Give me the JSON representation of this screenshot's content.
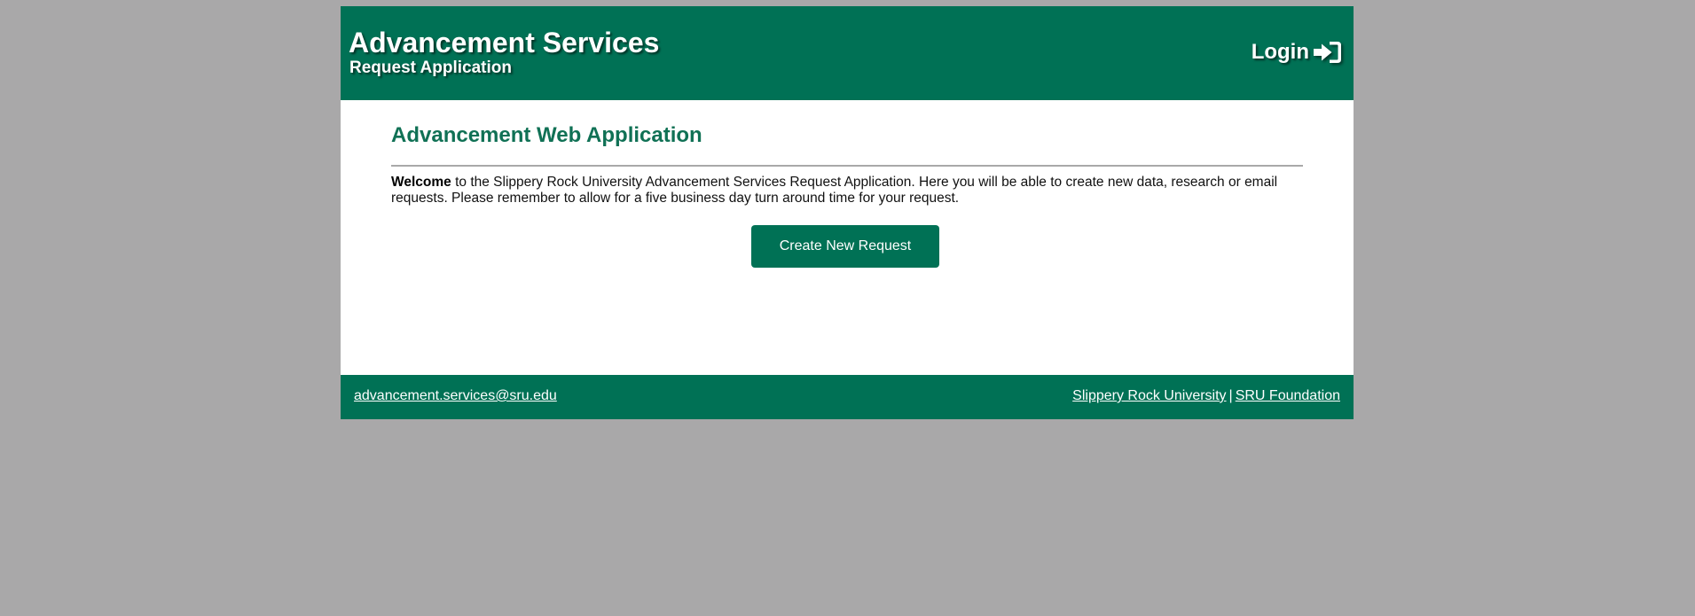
{
  "header": {
    "title": "Advancement Services",
    "subtitle": "Request Application",
    "login_label": "Login",
    "login_icon": "sign-in-icon"
  },
  "main": {
    "heading": "Advancement Web Application",
    "welcome_bold": "Welcome",
    "welcome_text": " to the Slippery Rock University Advancement Services Request Application. Here you will be able to create new data, research or email requests. Please remember to allow for a five business day turn around time for your request.",
    "cta_label": "Create New Request"
  },
  "footer": {
    "email": "advancement.services@sru.edu",
    "link_university": "Slippery Rock University",
    "separator": "|",
    "link_foundation": "SRU Foundation"
  },
  "colors": {
    "brand_green": "#007155",
    "page_background": "#a9a8a9",
    "divider": "#a9a9a9"
  }
}
